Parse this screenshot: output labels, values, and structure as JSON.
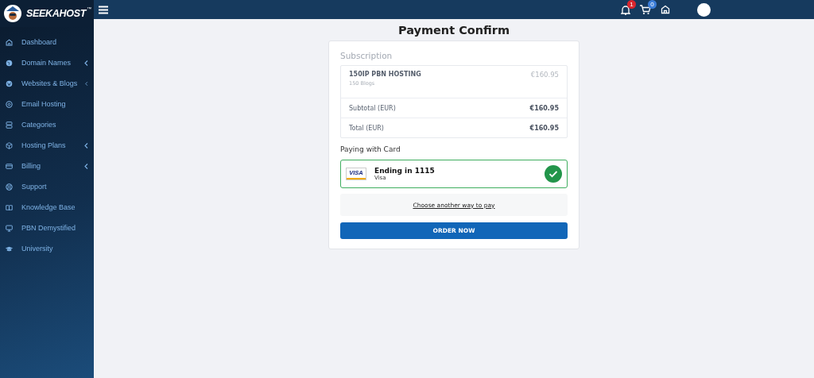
{
  "brand": {
    "name": "SEEKAHOST",
    "mark": "™"
  },
  "sidebar": {
    "items": [
      {
        "label": "Dashboard",
        "expandable": false
      },
      {
        "label": "Domain Names",
        "expandable": true
      },
      {
        "label": "Websites & Blogs",
        "expandable": true
      },
      {
        "label": "Email Hosting",
        "expandable": false
      },
      {
        "label": "Categories",
        "expandable": false
      },
      {
        "label": "Hosting Plans",
        "expandable": true
      },
      {
        "label": "Billing",
        "expandable": true
      },
      {
        "label": "Support",
        "expandable": false
      },
      {
        "label": "Knowledge Base",
        "expandable": false
      },
      {
        "label": "PBN Demystified",
        "expandable": false
      },
      {
        "label": "University",
        "expandable": false
      }
    ]
  },
  "topbar": {
    "notifications": {
      "count": "1",
      "color": "#d9262e"
    },
    "cart": {
      "count": "0",
      "color": "#3b7dd8"
    }
  },
  "page": {
    "title": "Payment Confirm"
  },
  "subscription": {
    "heading": "Subscription",
    "item": {
      "name": "150IP PBN HOSTING",
      "detail": "150 Blogs",
      "price": "€160.95"
    },
    "totals": [
      {
        "label": "Subtotal (EUR)",
        "amount": "€160.95"
      },
      {
        "label": "Total (EUR)",
        "amount": "€160.95"
      }
    ]
  },
  "payment": {
    "heading": "Paying with Card",
    "cards": [
      {
        "brand_logo": "VISA",
        "title": "Ending in 1115",
        "subtitle": "Visa",
        "selected": true
      }
    ],
    "alternative": "Choose another way to pay",
    "submit": "ORDER NOW"
  }
}
